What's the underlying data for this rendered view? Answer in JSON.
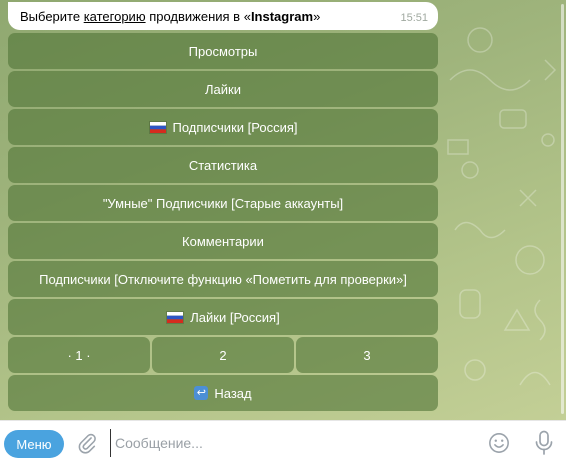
{
  "message": {
    "prefix": "Выберите ",
    "link": "категорию",
    "middle": " продвижения в «",
    "bold": "Instagram",
    "suffix": "»",
    "time": "15:51"
  },
  "keyboard": {
    "views": "Просмотры",
    "likes": "Лайки",
    "subs_russia": "Подписчики [Россия]",
    "stats": "Статистика",
    "smart_subs": "\"Умные\" Подписчики [Старые аккаунты]",
    "comments": "Комментарии",
    "subs_flag_off": "Подписчики [Отключите функцию «Пометить для проверки»]",
    "likes_russia": "Лайки [Россия]",
    "page1": "· 1 ·",
    "page2": "2",
    "page3": "3",
    "back": "Назад"
  },
  "input_bar": {
    "menu_label": "Меню",
    "placeholder": "Сообщение..."
  },
  "colors": {
    "button_bg": "#5a7c3e",
    "menu_bg": "#4aa3df",
    "back_icon": "#4c8fd6"
  }
}
